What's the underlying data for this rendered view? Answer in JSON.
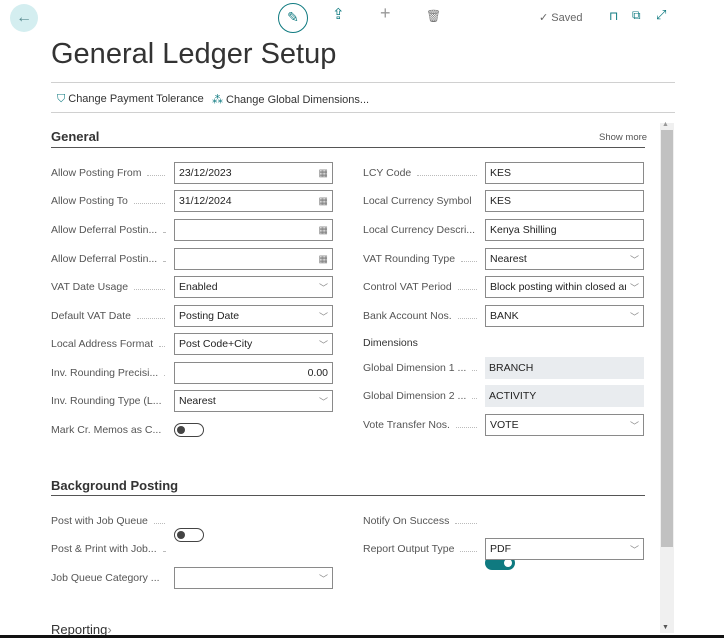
{
  "header": {
    "back": "←",
    "edit": "✎",
    "share": "⇪",
    "add": "+",
    "delete": "🗑",
    "saved": "✓ Saved",
    "bookmark": "⊓",
    "popout": "⧉",
    "expand": "⤢"
  },
  "title": "General Ledger Setup",
  "actions": [
    {
      "icon": "⛉",
      "label": "Change Payment Tolerance"
    },
    {
      "icon": "⁂",
      "label": "Change Global Dimensions..."
    }
  ],
  "general": {
    "title": "General",
    "show_more": "Show more",
    "left": [
      {
        "label": "Allow Posting From",
        "value": "23/12/2023",
        "type": "date"
      },
      {
        "label": "Allow Posting To",
        "value": "31/12/2024",
        "type": "date"
      },
      {
        "label": "Allow Deferral Postin...",
        "value": "",
        "type": "date"
      },
      {
        "label": "Allow Deferral Postin...",
        "value": "",
        "type": "date"
      },
      {
        "label": "VAT Date Usage",
        "value": "Enabled",
        "type": "select"
      },
      {
        "label": "Default VAT Date",
        "value": "Posting Date",
        "type": "select"
      },
      {
        "label": "Local Address Format",
        "value": "Post Code+City",
        "type": "select"
      },
      {
        "label": "Inv. Rounding Precisi...",
        "value": "0.00",
        "type": "number"
      },
      {
        "label": "Inv. Rounding Type (L...",
        "value": "Nearest",
        "type": "select"
      },
      {
        "label": "Mark Cr. Memos as C...",
        "value": "off",
        "type": "toggle"
      }
    ],
    "right": [
      {
        "label": "LCY Code",
        "value": "KES",
        "type": "text"
      },
      {
        "label": "Local Currency Symbol",
        "value": "KES",
        "type": "text"
      },
      {
        "label": "Local Currency Descri...",
        "value": "Kenya Shilling",
        "type": "text"
      },
      {
        "label": "VAT Rounding Type",
        "value": "Nearest",
        "type": "select"
      },
      {
        "label": "Control VAT Period",
        "value": "Block posting within closed and warn for released",
        "type": "select"
      },
      {
        "label": "Bank Account Nos.",
        "value": "BANK",
        "type": "select"
      }
    ],
    "dimensions_title": "Dimensions",
    "dimensions": [
      {
        "label": "Global Dimension 1 ...",
        "value": "BRANCH",
        "type": "readonly"
      },
      {
        "label": "Global Dimension 2 ...",
        "value": "ACTIVITY",
        "type": "readonly"
      },
      {
        "label": "Vote Transfer Nos.",
        "value": "VOTE",
        "type": "select"
      }
    ]
  },
  "background": {
    "title": "Background Posting",
    "left": [
      {
        "label": "Post with Job Queue",
        "value": "off",
        "type": "toggle"
      },
      {
        "label": "Post & Print with Job...",
        "value": "off",
        "type": "toggle"
      },
      {
        "label": "Job Queue Category ...",
        "value": "",
        "type": "select"
      }
    ],
    "right": [
      {
        "label": "Notify On Success",
        "value": "on",
        "type": "toggle"
      },
      {
        "label": "Report Output Type",
        "value": "PDF",
        "type": "select"
      }
    ]
  },
  "reporting": {
    "title": "Reporting",
    "chevron": "›"
  },
  "scroll": {
    "up": "▲",
    "down": "▼"
  }
}
